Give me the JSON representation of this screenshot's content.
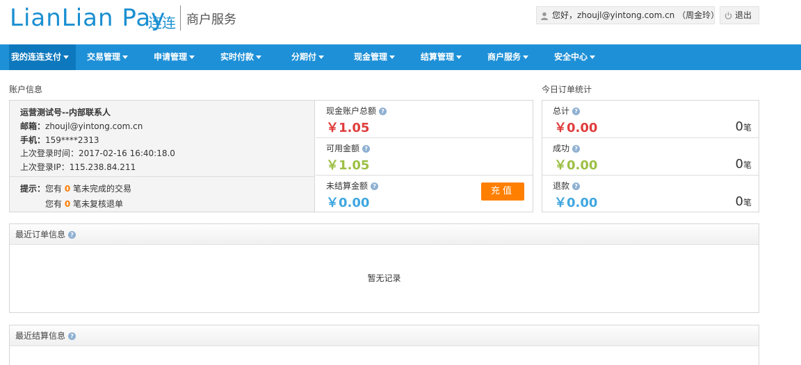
{
  "brand": {
    "logo": "LianLian Pay",
    "logo_cn": "连连",
    "subtitle": "商户服务"
  },
  "user": {
    "greeting": "您好，zhoujl@yintong.com.cn （周金玲）",
    "logout": "退出"
  },
  "nav": [
    {
      "label": "我的连连支付"
    },
    {
      "label": "交易管理"
    },
    {
      "label": "申请管理"
    },
    {
      "label": "实时付款"
    },
    {
      "label": "分期付"
    },
    {
      "label": "现金管理"
    },
    {
      "label": "结算管理"
    },
    {
      "label": "商户服务"
    },
    {
      "label": "安全中心"
    }
  ],
  "account": {
    "section_title": "账户信息",
    "name": "运营测试号--内部联系人",
    "email_label": "邮箱：",
    "email": "zhoujl@yintong.com.cn",
    "phone_label": "手机：",
    "phone": "159****2313",
    "last_login_time_label": "上次登录时间：",
    "last_login_time": "2017-02-16 16:40:18.0",
    "last_login_ip_label": "上次登录IP：",
    "last_login_ip": "115.238.84.211",
    "tip_label": "提示：",
    "tip1_prefix": "您有",
    "tip1_count": "0",
    "tip1_suffix": "笔未完成的交易",
    "tip2_prefix": "您有",
    "tip2_count": "0",
    "tip2_suffix": "笔未复核退单",
    "cash_total_label": "现金账户总额",
    "cash_total": "￥1.05",
    "available_label": "可用金额",
    "available": "￥1.05",
    "unsettled_label": "未结算金额",
    "unsettled": "￥0.00",
    "recharge": "充值"
  },
  "today": {
    "section_title": "今日订单统计",
    "rows": [
      {
        "label": "总计",
        "amount": "￥0.00",
        "count": "0",
        "unit": "笔"
      },
      {
        "label": "成功",
        "amount": "￥0.00",
        "count": "0",
        "unit": "笔"
      },
      {
        "label": "退款",
        "amount": "￥0.00",
        "count": "0",
        "unit": "笔"
      }
    ]
  },
  "recent_orders": {
    "title": "最近订单信息",
    "empty": "暂无记录"
  },
  "recent_settlements": {
    "title": "最近结算信息"
  },
  "colors": {
    "nav_bg": "#1e90d7",
    "red_amount": "#e03c3c",
    "green_amount": "#9cbf44",
    "blue_amount": "#3fa6e0",
    "orange": "#ff7f00"
  }
}
